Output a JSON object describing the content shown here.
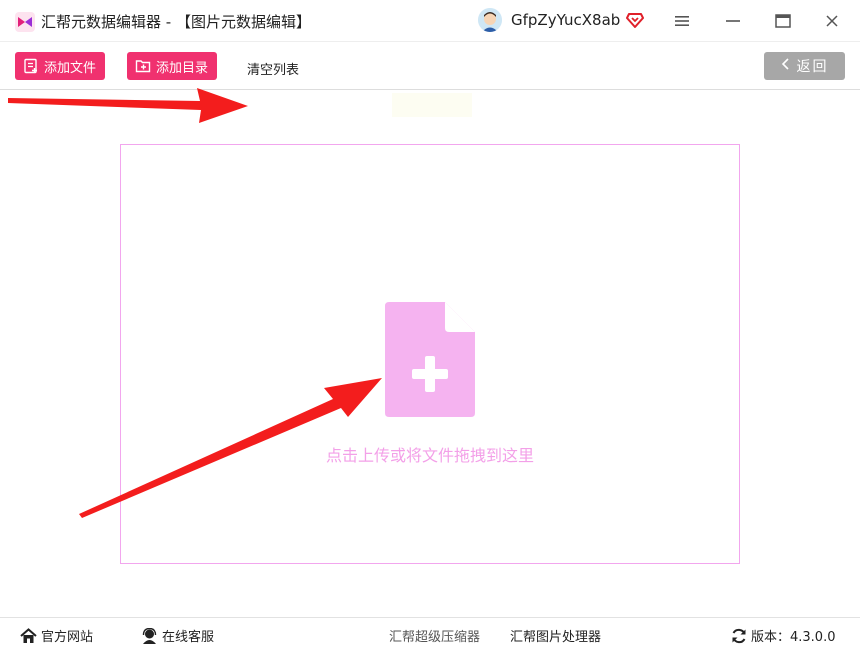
{
  "window": {
    "title": "汇帮元数据编辑器 - 【图片元数据编辑】",
    "username": "GfpZyYucX8ab",
    "menu_icon": "hamburger-menu-icon",
    "maximize_icon": "maximize-icon",
    "close_icon": "close-icon"
  },
  "toolbar": {
    "add_file_label": "添加文件",
    "add_folder_label": "添加目录",
    "clear_list_label": "清空列表",
    "back_label": "返回"
  },
  "dropzone": {
    "hint": "点击上传或将文件拖拽到这里"
  },
  "footer": {
    "website_label": "官方网站",
    "support_label": "在线客服",
    "compressor_label": "汇帮超级压缩器",
    "image_tool_label": "汇帮图片处理器",
    "version_label": "版本：4.3.0.0"
  },
  "colors": {
    "accent": "#f0316f",
    "dropzone_border": "#f2a6ee",
    "file_icon": "#f5b3f0",
    "annotation_arrow": "#f31d1d",
    "back_button": "#a7a7a7"
  }
}
